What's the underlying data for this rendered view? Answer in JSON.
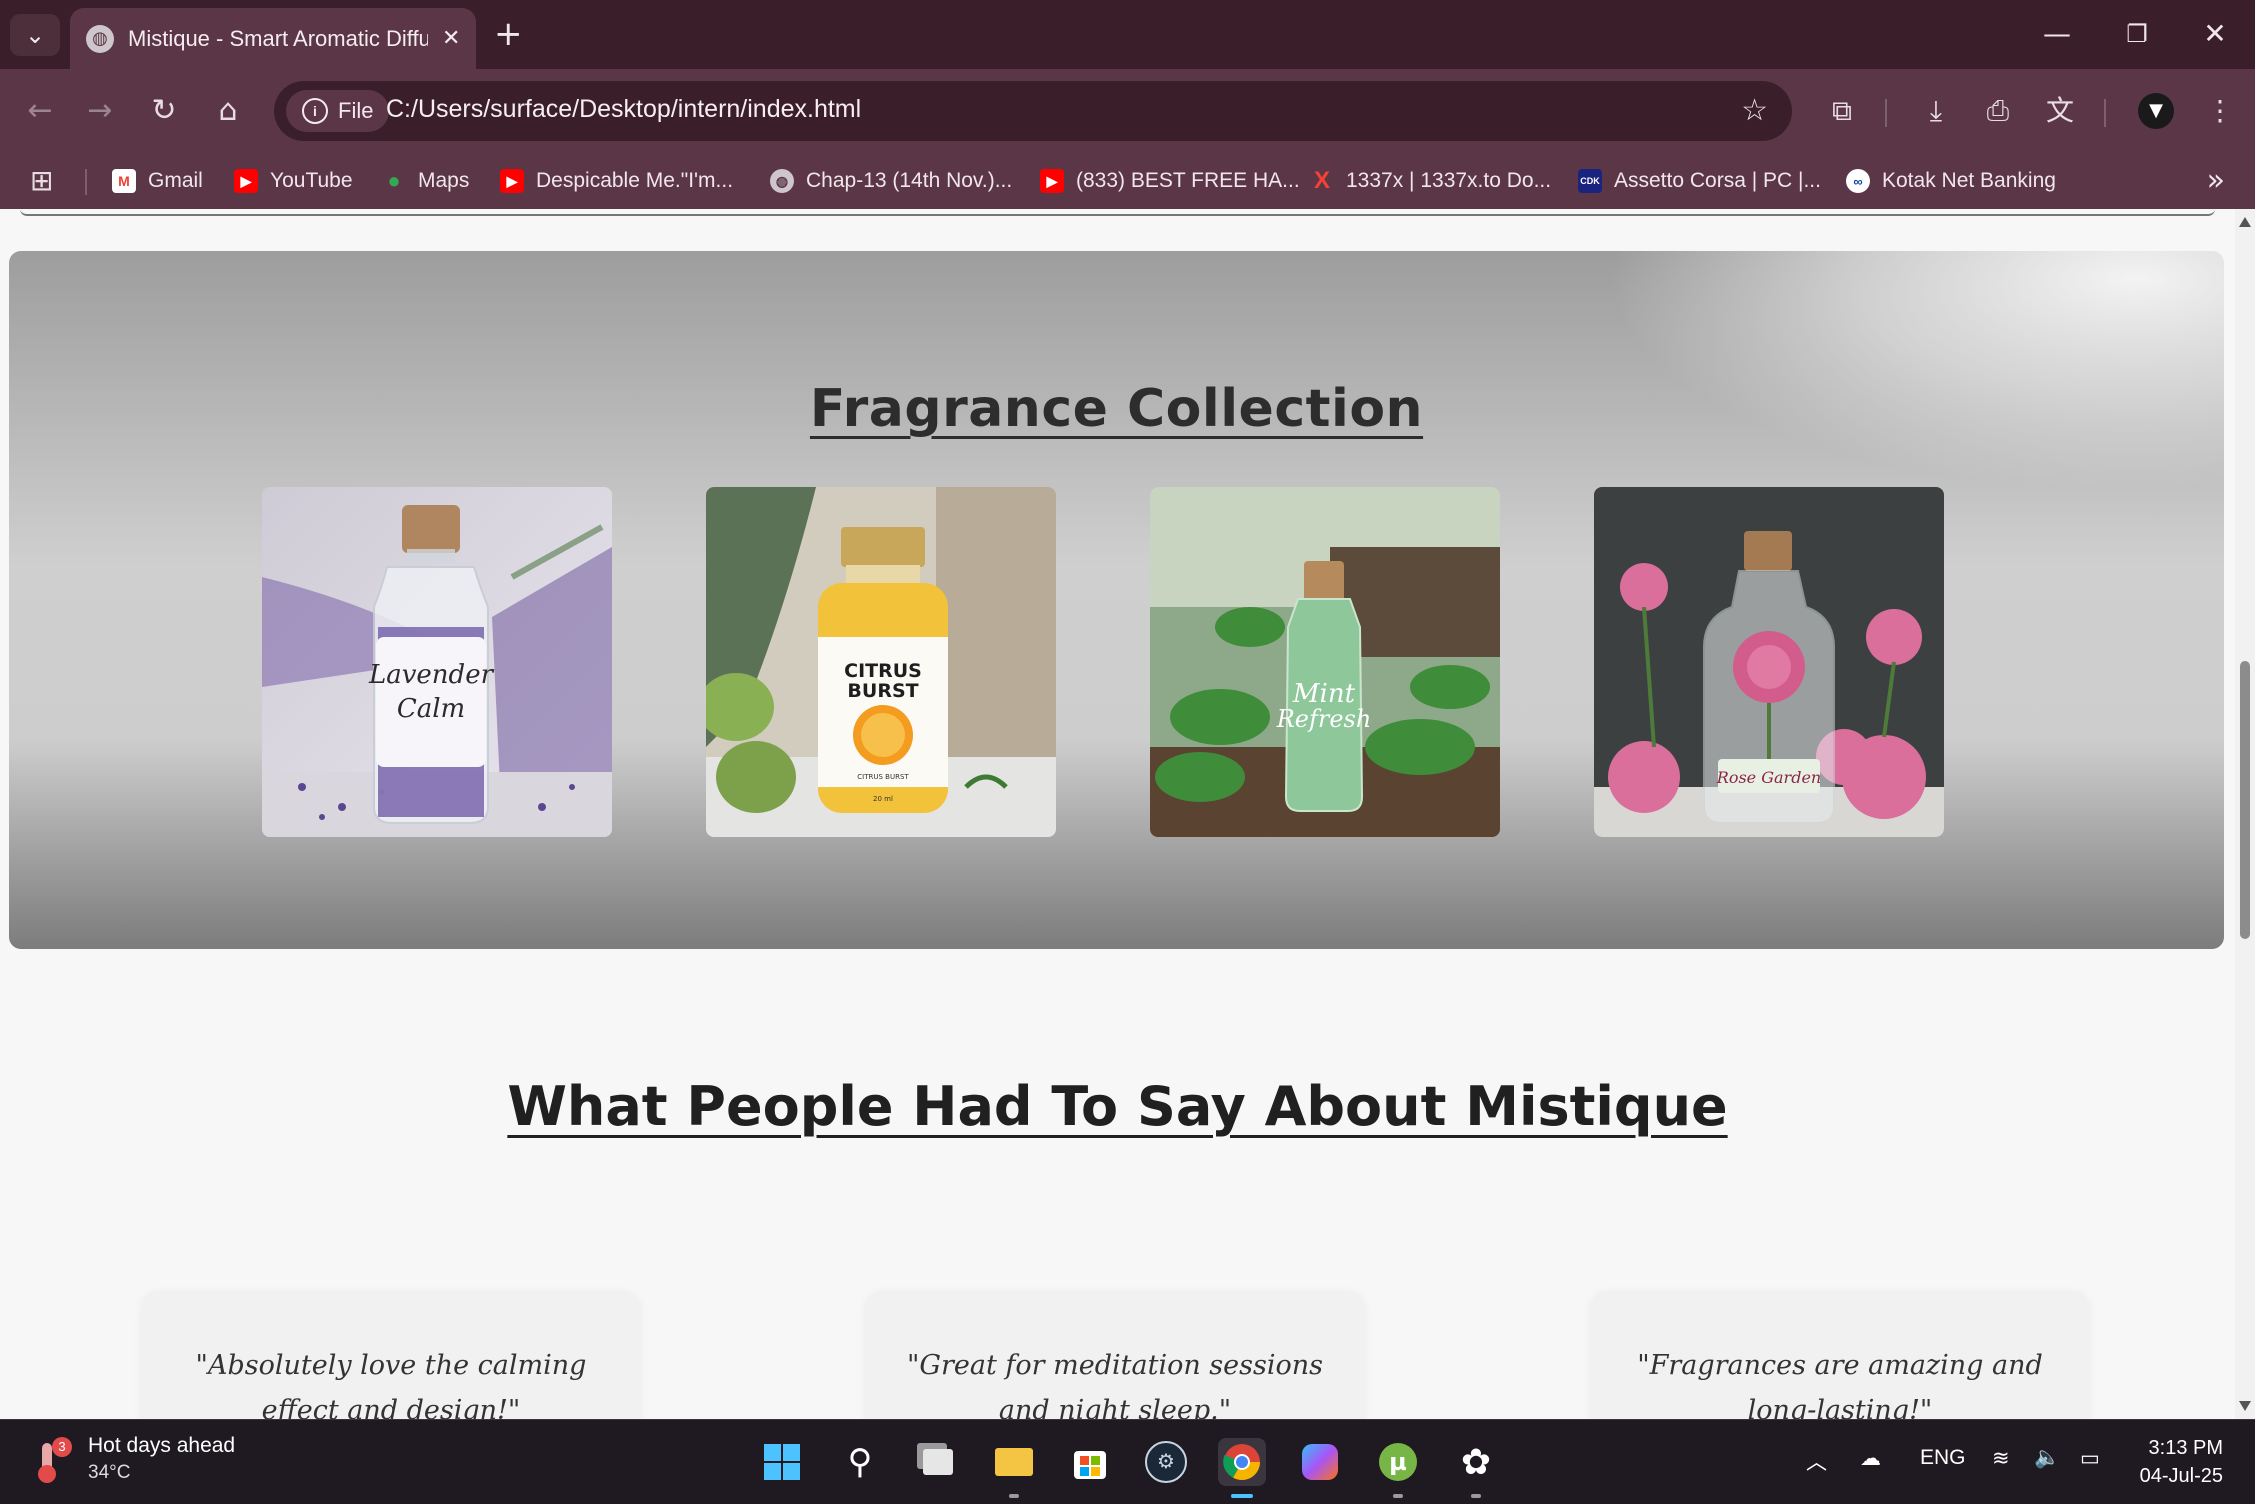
{
  "browser": {
    "tab_title": "Mistique - Smart Aromatic Diffu",
    "url_chip": "File",
    "url": "C:/Users/surface/Desktop/intern/index.html"
  },
  "bookmarks": [
    {
      "label": "Gmail",
      "icon": "gmail-icon",
      "color": "#ea4335"
    },
    {
      "label": "YouTube",
      "icon": "youtube-icon",
      "color": "#ff0000"
    },
    {
      "label": "Maps",
      "icon": "maps-icon",
      "color": "#34a853"
    },
    {
      "label": "Despicable Me.\"I'm...",
      "icon": "youtube-icon",
      "color": "#ff0000"
    },
    {
      "label": "Chap-13 (14th Nov.)...",
      "icon": "globe-icon",
      "color": "#9e9e9e"
    },
    {
      "label": "(833) BEST FREE HA...",
      "icon": "youtube-icon",
      "color": "#ff0000"
    },
    {
      "label": "1337x | 1337x.to Do...",
      "icon": "1337x-icon",
      "color": "#f44336"
    },
    {
      "label": "Assetto Corsa | PC |...",
      "icon": "cdk-icon",
      "color": "#1a237e"
    },
    {
      "label": "Kotak Net Banking",
      "icon": "kotak-icon",
      "color": "#0d47a1"
    }
  ],
  "page": {
    "collection_title": "Fragrance Collection",
    "products": [
      {
        "name": "Lavender Calm",
        "label_line1": "Lavender",
        "label_line2": "Calm"
      },
      {
        "name": "Citrus Burst",
        "label_line1": "CITRUS",
        "label_line2": "BURST",
        "sub": "CITRUS BURST",
        "volume": "20 ml"
      },
      {
        "name": "Mint Refresh",
        "label_line1": "Mint",
        "label_line2": "Refresh"
      },
      {
        "name": "Rose Garden",
        "label_line1": "Rose Garden"
      }
    ],
    "reviews_title": "What People Had To Say About Mistique",
    "reviews": [
      {
        "text": "\"Absolutely love the calming effect and design!\""
      },
      {
        "text": "\"Great for meditation sessions and night sleep.\""
      },
      {
        "text": "\"Fragrances are amazing and long-lasting!\""
      }
    ]
  },
  "taskbar": {
    "weather_title": "Hot days ahead",
    "weather_temp": "34°C",
    "weather_badge": "3",
    "language": "ENG",
    "time": "3:13 PM",
    "date": "04-Jul-25"
  }
}
